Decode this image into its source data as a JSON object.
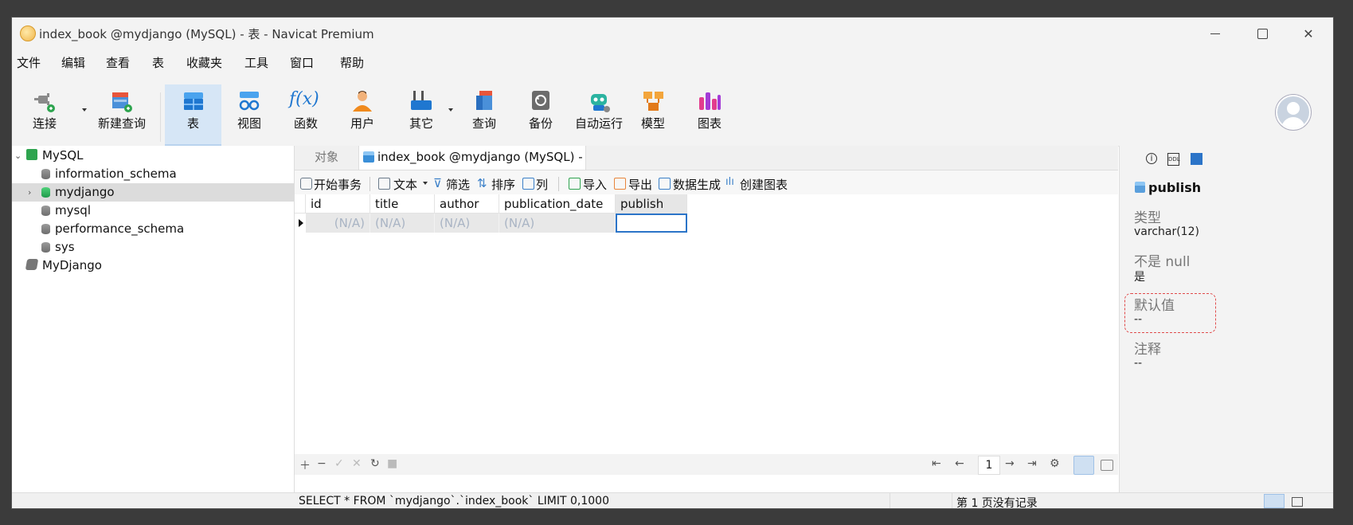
{
  "window": {
    "title": "index_book @mydjango (MySQL) - 表 - Navicat Premium"
  },
  "menu": [
    "文件",
    "编辑",
    "查看",
    "表",
    "收藏夹",
    "工具",
    "窗口",
    "帮助"
  ],
  "toolbar": {
    "connect": "连接",
    "new_query": "新建查询",
    "table": "表",
    "view": "视图",
    "function": "函数",
    "user": "用户",
    "other": "其它",
    "query": "查询",
    "backup": "备份",
    "automation": "自动运行",
    "model": "模型",
    "chart": "图表",
    "function_icon_text": "f(x)"
  },
  "tree": [
    {
      "label": "MySQL",
      "level": 0,
      "expanded": true
    },
    {
      "label": "information_schema",
      "level": 1
    },
    {
      "label": "mydjango",
      "level": 1,
      "selected": true,
      "collapsed_arrow": true
    },
    {
      "label": "mysql",
      "level": 1
    },
    {
      "label": "performance_schema",
      "level": 1
    },
    {
      "label": "sys",
      "level": 1
    },
    {
      "label": "MyDjango",
      "level": 0
    }
  ],
  "tabs": {
    "objects": "对象",
    "active": "index_book @mydjango (MySQL) - 表"
  },
  "subtoolbar": {
    "begin_transaction": "开始事务",
    "text": "文本",
    "filter": "筛选",
    "sort": "排序",
    "columns": "列",
    "import": "导入",
    "export": "导出",
    "data_generation": "数据生成",
    "create_chart": "创建图表"
  },
  "grid": {
    "columns": [
      "id",
      "title",
      "author",
      "publication_date",
      "publish"
    ],
    "row": [
      "(N/A)",
      "(N/A)",
      "(N/A)",
      "(N/A)",
      ""
    ],
    "selected_column": "publish"
  },
  "pager": {
    "page": "1"
  },
  "right_panel": {
    "field_name": "publish",
    "type_label": "类型",
    "type_value": "varchar(12)",
    "not_null_label": "不是 null",
    "not_null_value": "是",
    "default_label": "默认值",
    "default_value": "--",
    "comment_label": "注释",
    "comment_value": "--",
    "info_icon_text": "i",
    "ddl_icon_text": "DDL"
  },
  "status": {
    "sql": "SELECT * FROM `mydjango`.`index_book` LIMIT 0,1000",
    "records": "第 1 页没有记录"
  },
  "colors": {
    "accent": "#2b74c8",
    "highlight_border": "#e04a4a",
    "selected_row": "#dcdcdc"
  }
}
